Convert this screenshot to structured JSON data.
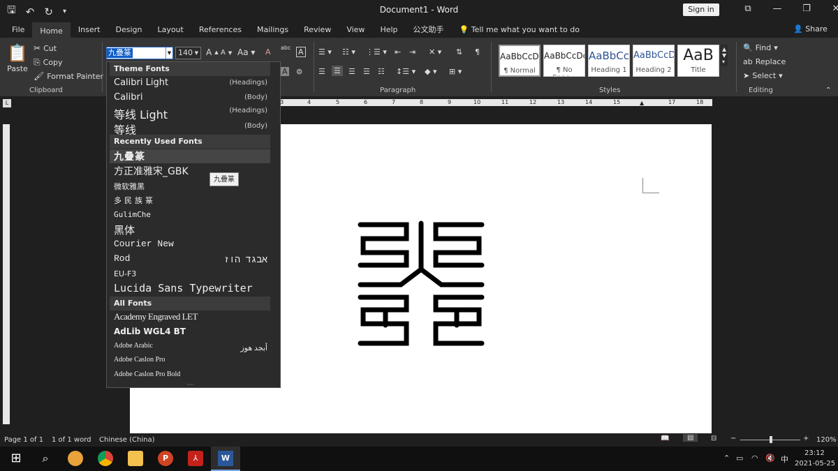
{
  "title_bar": {
    "document_title": "Document1 - Word",
    "sign_in": "Sign in"
  },
  "tabs": [
    "File",
    "Home",
    "Insert",
    "Design",
    "Layout",
    "References",
    "Mailings",
    "Review",
    "View",
    "Help",
    "公文助手"
  ],
  "tell_me": "Tell me what you want to do",
  "share": "Share",
  "clipboard": {
    "paste": "Paste",
    "cut": "Cut",
    "copy": "Copy",
    "format_painter": "Format Painter",
    "group_label": "Clipboard"
  },
  "font": {
    "name": "九疊篆",
    "size": "140"
  },
  "paragraph": {
    "group_label": "Paragraph"
  },
  "styles": {
    "group_label": "Styles",
    "items": [
      {
        "preview": "AaBbCcDc",
        "name": "¶ Normal"
      },
      {
        "preview": "AaBbCcDc",
        "name": "¶ No Spac..."
      },
      {
        "preview": "AaBbCc",
        "name": "Heading 1"
      },
      {
        "preview": "AaBbCcD",
        "name": "Heading 2"
      },
      {
        "preview": "AaB",
        "name": "Title"
      }
    ]
  },
  "editing": {
    "find": "Find",
    "replace": "Replace",
    "select": "Select",
    "group_label": "Editing"
  },
  "ruler": {
    "labels": [
      "3",
      "4",
      "5",
      "6",
      "7",
      "8",
      "9",
      "10",
      "11",
      "12",
      "13",
      "14",
      "15",
      "17",
      "18"
    ]
  },
  "font_dropdown": {
    "sections": {
      "theme": "Theme Fonts",
      "recent": "Recently Used Fonts",
      "all": "All Fonts"
    },
    "theme_fonts": [
      {
        "name": "Calibri Light",
        "tag": "(Headings)"
      },
      {
        "name": "Calibri",
        "tag": "(Body)"
      },
      {
        "name": "等线 Light",
        "tag": "(Headings)"
      },
      {
        "name": "等线",
        "tag": "(Body)"
      }
    ],
    "recent_fonts": [
      {
        "name": "九疊篆"
      },
      {
        "name": "方正准雅宋_GBK"
      },
      {
        "name": "微软雅黑"
      },
      {
        "name": "多民族篆"
      },
      {
        "name": "GulimChe"
      },
      {
        "name": "黑体"
      },
      {
        "name": "Courier New"
      },
      {
        "name": "Rod",
        "sample": "אבגד הוז"
      },
      {
        "name": "EU-F3"
      },
      {
        "name": "Lucida Sans Typewriter"
      }
    ],
    "all_fonts": [
      {
        "name": "Academy Engraved LET"
      },
      {
        "name": "AdLib WGL4 BT"
      },
      {
        "name": "Adobe Arabic",
        "sample": "أبجد هوز"
      },
      {
        "name": "Adobe Caslon Pro"
      },
      {
        "name": "Adobe Caslon Pro Bold"
      }
    ],
    "tooltip": "九疊篆"
  },
  "status_bar": {
    "page": "Page 1 of 1",
    "words": "1 of 1 word",
    "language": "Chinese (China)",
    "zoom": "120%"
  },
  "taskbar": {
    "time": "23:12",
    "date": "2021-05-25",
    "ime": "中"
  },
  "colors": {
    "accent": "#2b579a",
    "ribbon_bg": "#353535",
    "chrome_bg": "#1f1f1f"
  }
}
